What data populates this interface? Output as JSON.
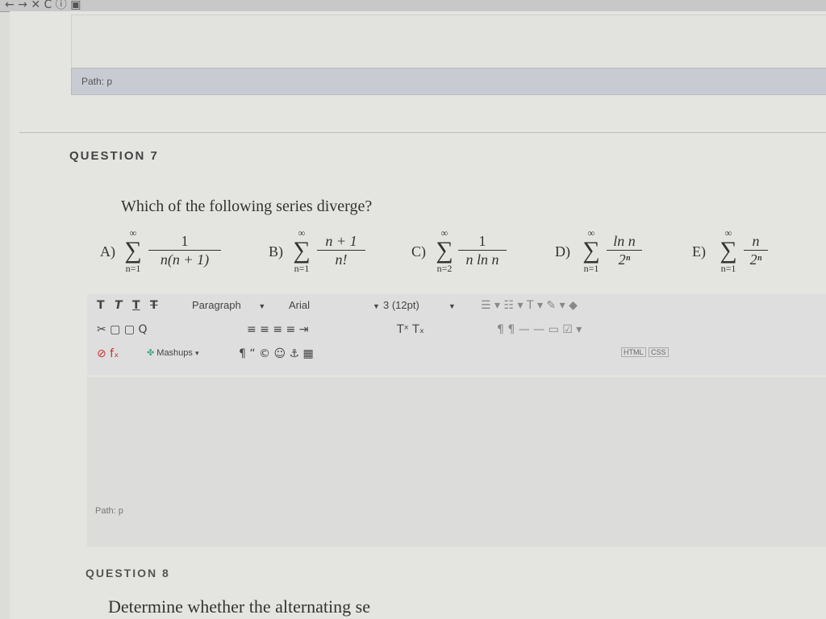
{
  "browser": {
    "nav_icons": "← → ✕ C ⓘ ▣"
  },
  "previous": {
    "path_label": "Path: p"
  },
  "question7": {
    "title": "QUESTION 7",
    "text": "Which of the following series diverge?",
    "choices": [
      {
        "label": "A)",
        "upper": "∞",
        "lower": "n=1",
        "numerator": "1",
        "denominator": "n(n + 1)"
      },
      {
        "label": "B)",
        "upper": "∞",
        "lower": "n=1",
        "numerator": "n + 1",
        "denominator": "n!"
      },
      {
        "label": "C)",
        "upper": "∞",
        "lower": "n=2",
        "numerator": "1",
        "denominator": "n ln n"
      },
      {
        "label": "D)",
        "upper": "∞",
        "lower": "n=1",
        "numerator": "ln n",
        "denominator": "2ⁿ"
      },
      {
        "label": "E)",
        "upper": "∞",
        "lower": "n=1",
        "numerator": "n",
        "denominator": "2ⁿ"
      }
    ]
  },
  "toolbar": {
    "row1": {
      "format_icons": [
        "T",
        "T",
        "T",
        "T"
      ],
      "paragraph": "Paragraph",
      "font": "Arial",
      "size": "3 (12pt)",
      "right_icons": "☰ ▾ ☷ ▾ T ▾ ✎ ▾ ◆"
    },
    "row2": {
      "icons_left": "✂ ▢ ▢ Q",
      "icons_mid": "≡ ≡ ≡ ≡ ⇥",
      "tsup": "Tˣ Tₓ",
      "icons_right": "¶ ¶ — — ▭ ☑ ▾"
    },
    "row3": {
      "icons_left": "⊘ fₓ",
      "mashups": "Mashups",
      "icons_mid": "¶ “ © ☺ ⚓ ▦",
      "html": "HTML",
      "css": "CSS"
    }
  },
  "editor": {
    "path_label": "Path: p"
  },
  "question8": {
    "title": "QUESTION 8",
    "text": "Determine whether the alternating se"
  }
}
